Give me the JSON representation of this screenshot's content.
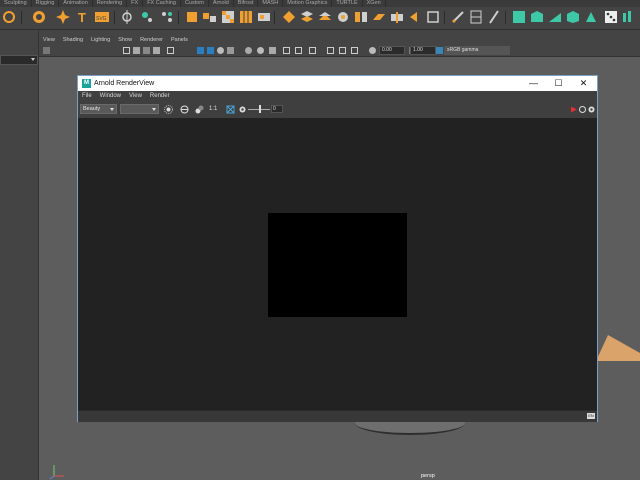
{
  "shelf_tabs": [
    "Sculpting",
    "Rigging",
    "Animation",
    "Rendering",
    "FX",
    "FX Caching",
    "Custom",
    "Arnold",
    "Bifrost",
    "MASH",
    "Motion Graphics",
    "TURTLE",
    "XGen"
  ],
  "viewport": {
    "menu": [
      "View",
      "Shading",
      "Lighting",
      "Show",
      "Renderer",
      "Panels"
    ],
    "exposure_value": "0.00",
    "gamma_value": "1.00",
    "color_space": "sRGB gamma",
    "camera_label": "persp"
  },
  "render_view": {
    "logo_letter": "M",
    "title": "Arnold RenderView",
    "window_controls": {
      "minimize": "—",
      "maximize": "☐",
      "close": "✕"
    },
    "menu": [
      "File",
      "Window",
      "View",
      "Render"
    ],
    "aov_select": "Beauty",
    "camera_select": "",
    "ratio_label": "1:1",
    "exposure_value": "0",
    "status_icon": "EN",
    "colors": {
      "accent_red": "#e03030",
      "title_bg": "#ffffff",
      "canvas": "#222222",
      "image": "#000000"
    }
  },
  "colors": {
    "shelf_accent": "#f0a030",
    "teal_icon": "#3dc9a8",
    "cone": "#d9a36a"
  }
}
